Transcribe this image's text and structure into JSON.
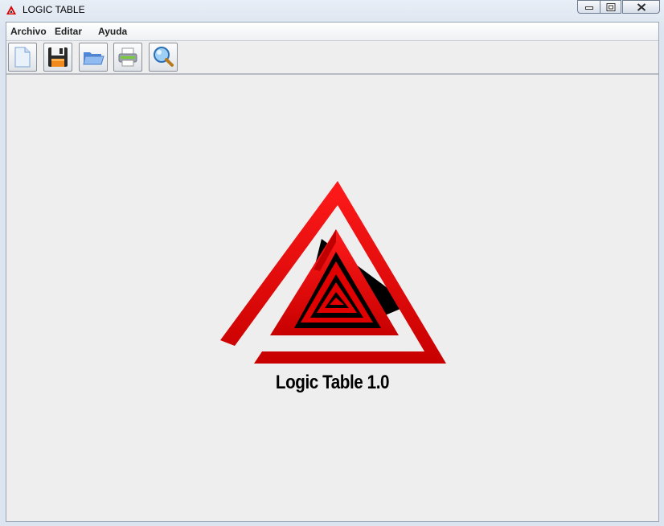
{
  "window": {
    "title": "LOGIC TABLE"
  },
  "menu": {
    "items": [
      "Archivo",
      "Editar",
      "Ayuda"
    ]
  },
  "toolbar": {
    "buttons": [
      {
        "icon": "new-document-icon"
      },
      {
        "icon": "floppy-disk-save-icon"
      },
      {
        "icon": "open-folder-icon"
      },
      {
        "icon": "printer-icon"
      },
      {
        "icon": "magnifier-search-icon"
      }
    ]
  },
  "splash": {
    "caption": "Logic Table 1.0"
  },
  "colors": {
    "logo_red": "#e10000",
    "logo_black": "#000000",
    "client_bg": "#eeeeee"
  }
}
